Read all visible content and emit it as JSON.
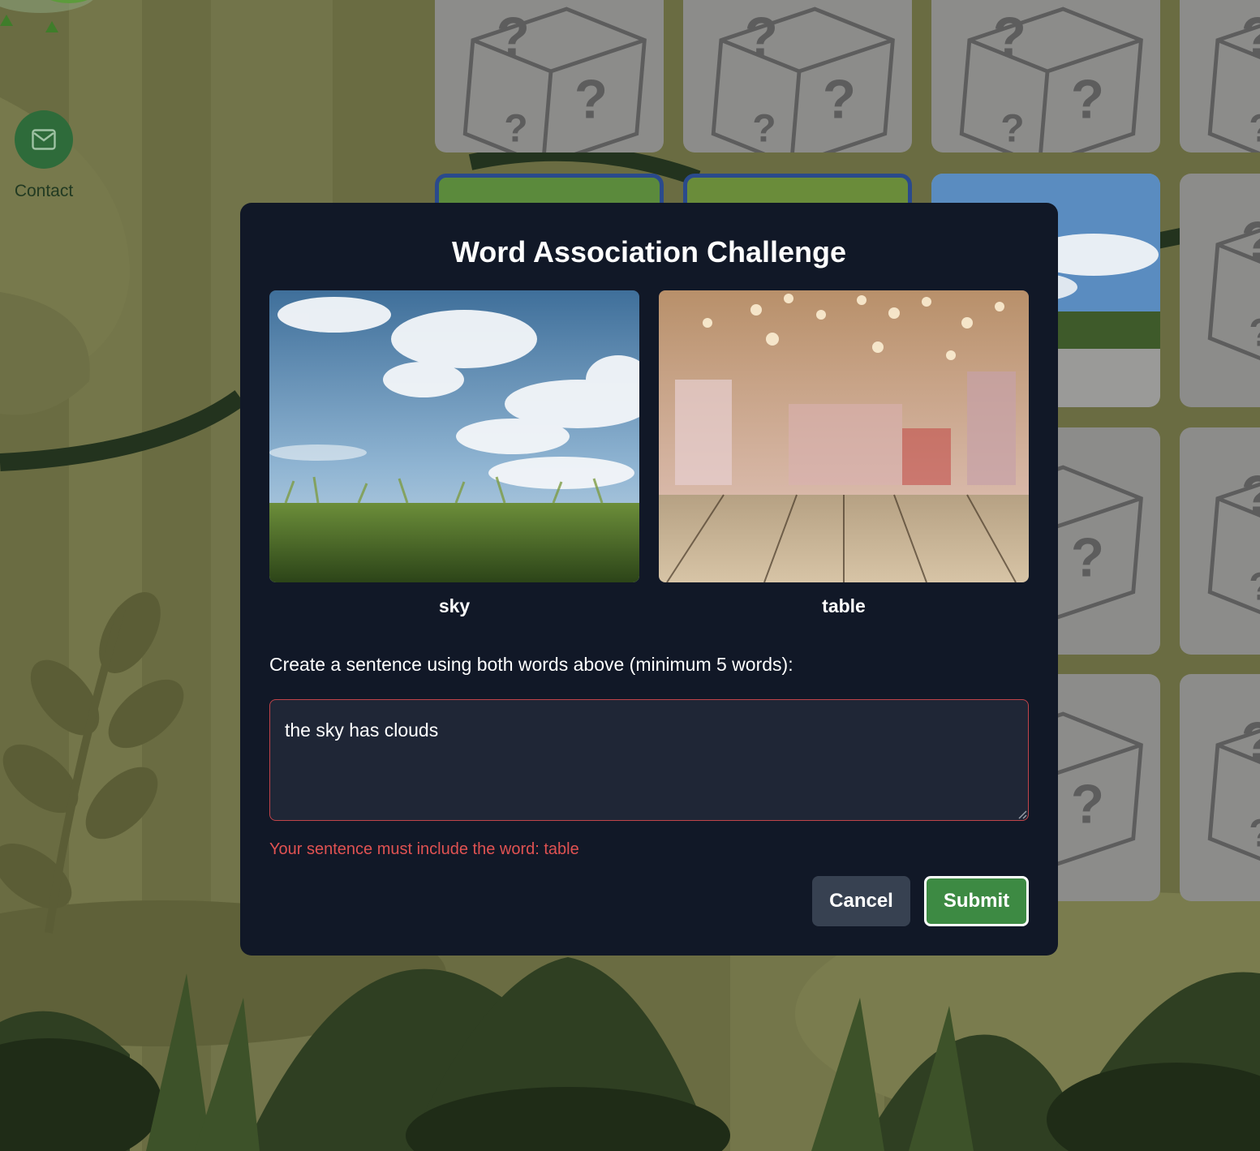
{
  "sidebar": {
    "contact_label": "Contact"
  },
  "modal": {
    "title": "Word Association Challenge",
    "words": [
      {
        "word": "sky"
      },
      {
        "word": "table"
      }
    ],
    "prompt": "Create a sentence using both words above (minimum 5 words):",
    "sentence_value": "the sky has clouds",
    "error": "Your sentence must include the word: table",
    "cancel_label": "Cancel",
    "submit_label": "Submit"
  },
  "colors": {
    "modal_bg": "#111827",
    "submit": "#3d8a43",
    "cancel": "#374151",
    "error": "#e05252",
    "contact": "#2e6b3a"
  },
  "icons": {
    "contact": "mail-icon",
    "card_back": "dice-icon"
  }
}
